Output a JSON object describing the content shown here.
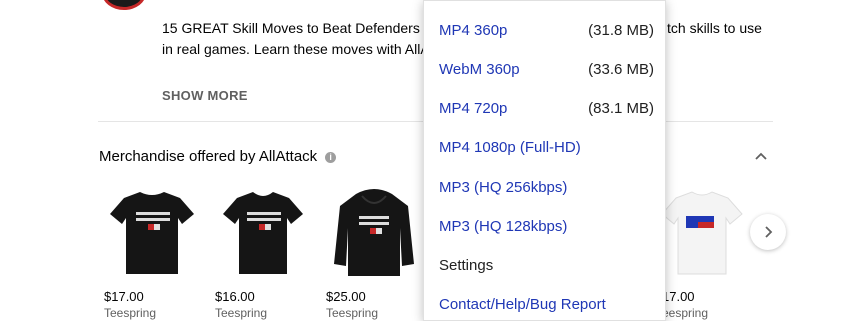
{
  "description": {
    "line1_start": "15 GREAT Skill Moves to Beat Defenders in",
    "line1_end": "tch skills to use",
    "line2_start": "in real games. Learn these moves with AllA",
    "show_more": "SHOW MORE"
  },
  "merch": {
    "title": "Merchandise offered by AllAttack",
    "info_icon": "i",
    "items": [
      {
        "price": "$17.00",
        "seller": "Teespring",
        "type": "tshirt-black"
      },
      {
        "price": "$16.00",
        "seller": "Teespring",
        "type": "tshirt-black-v"
      },
      {
        "price": "$25.00",
        "seller": "Teespring",
        "type": "hoodie-black"
      },
      {
        "price": "17.00",
        "seller": "eespring",
        "type": "tshirt-white"
      }
    ],
    "shirt_print": "LEARN THE BEAUTIFUL GAME"
  },
  "download_menu": {
    "items": [
      {
        "label": "MP4 360p",
        "size": "(31.8 MB)"
      },
      {
        "label": "WebM 360p",
        "size": "(33.6 MB)"
      },
      {
        "label": "MP4 720p",
        "size": "(83.1 MB)"
      },
      {
        "label": "MP4 1080p (Full-HD)",
        "size": ""
      },
      {
        "label": "MP3 (HQ 256kbps)",
        "size": ""
      },
      {
        "label": "MP3 (HQ 128kbps)",
        "size": ""
      }
    ],
    "settings": "Settings",
    "contact": "Contact/Help/Bug Report"
  },
  "colors": {
    "menu_link": "#1f37b5",
    "text": "#030303",
    "muted": "#606060"
  }
}
